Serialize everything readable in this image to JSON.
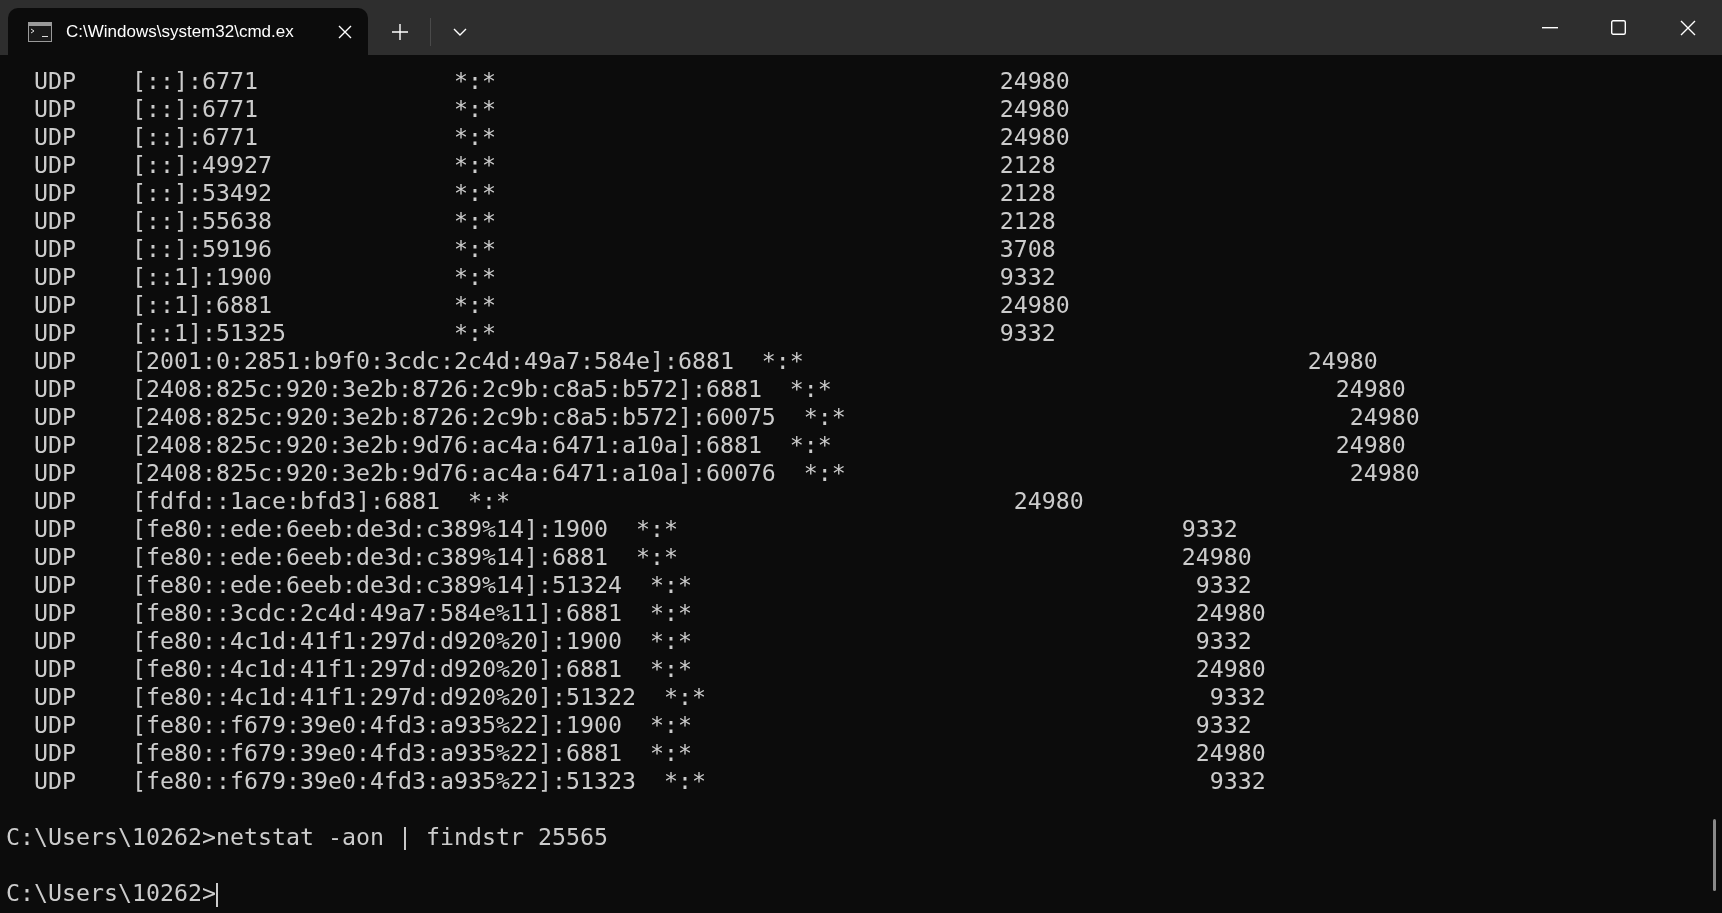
{
  "tab": {
    "title": "C:\\Windows\\system32\\cmd.ex",
    "selected": true
  },
  "rows": [
    {
      "proto": "UDP",
      "local": "[::]:6771",
      "foreign": "*:*",
      "pid": "24980"
    },
    {
      "proto": "UDP",
      "local": "[::]:6771",
      "foreign": "*:*",
      "pid": "24980"
    },
    {
      "proto": "UDP",
      "local": "[::]:6771",
      "foreign": "*:*",
      "pid": "24980"
    },
    {
      "proto": "UDP",
      "local": "[::]:49927",
      "foreign": "*:*",
      "pid": "2128"
    },
    {
      "proto": "UDP",
      "local": "[::]:53492",
      "foreign": "*:*",
      "pid": "2128"
    },
    {
      "proto": "UDP",
      "local": "[::]:55638",
      "foreign": "*:*",
      "pid": "2128"
    },
    {
      "proto": "UDP",
      "local": "[::]:59196",
      "foreign": "*:*",
      "pid": "3708"
    },
    {
      "proto": "UDP",
      "local": "[::1]:1900",
      "foreign": "*:*",
      "pid": "9332"
    },
    {
      "proto": "UDP",
      "local": "[::1]:6881",
      "foreign": "*:*",
      "pid": "24980"
    },
    {
      "proto": "UDP",
      "local": "[::1]:51325",
      "foreign": "*:*",
      "pid": "9332"
    },
    {
      "proto": "UDP",
      "local": "[2001:0:2851:b9f0:3cdc:2c4d:49a7:584e]:6881",
      "foreign": "*:*",
      "pid": "24980"
    },
    {
      "proto": "UDP",
      "local": "[2408:825c:920:3e2b:8726:2c9b:c8a5:b572]:6881",
      "foreign": "*:*",
      "pid": "24980"
    },
    {
      "proto": "UDP",
      "local": "[2408:825c:920:3e2b:8726:2c9b:c8a5:b572]:60075",
      "foreign": "*:*",
      "pid": "24980"
    },
    {
      "proto": "UDP",
      "local": "[2408:825c:920:3e2b:9d76:ac4a:6471:a10a]:6881",
      "foreign": "*:*",
      "pid": "24980"
    },
    {
      "proto": "UDP",
      "local": "[2408:825c:920:3e2b:9d76:ac4a:6471:a10a]:60076",
      "foreign": "*:*",
      "pid": "24980"
    },
    {
      "proto": "UDP",
      "local": "[fdfd::1ace:bfd3]:6881",
      "foreign": "*:*",
      "pid": "24980"
    },
    {
      "proto": "UDP",
      "local": "[fe80::ede:6eeb:de3d:c389%14]:1900",
      "foreign": "*:*",
      "pid": "9332"
    },
    {
      "proto": "UDP",
      "local": "[fe80::ede:6eeb:de3d:c389%14]:6881",
      "foreign": "*:*",
      "pid": "24980"
    },
    {
      "proto": "UDP",
      "local": "[fe80::ede:6eeb:de3d:c389%14]:51324",
      "foreign": "*:*",
      "pid": "9332"
    },
    {
      "proto": "UDP",
      "local": "[fe80::3cdc:2c4d:49a7:584e%11]:6881",
      "foreign": "*:*",
      "pid": "24980"
    },
    {
      "proto": "UDP",
      "local": "[fe80::4c1d:41f1:297d:d920%20]:1900",
      "foreign": "*:*",
      "pid": "9332"
    },
    {
      "proto": "UDP",
      "local": "[fe80::4c1d:41f1:297d:d920%20]:6881",
      "foreign": "*:*",
      "pid": "24980"
    },
    {
      "proto": "UDP",
      "local": "[fe80::4c1d:41f1:297d:d920%20]:51322",
      "foreign": "*:*",
      "pid": "9332"
    },
    {
      "proto": "UDP",
      "local": "[fe80::f679:39e0:4fd3:a935%22]:1900",
      "foreign": "*:*",
      "pid": "9332"
    },
    {
      "proto": "UDP",
      "local": "[fe80::f679:39e0:4fd3:a935%22]:6881",
      "foreign": "*:*",
      "pid": "24980"
    },
    {
      "proto": "UDP",
      "local": "[fe80::f679:39e0:4fd3:a935%22]:51323",
      "foreign": "*:*",
      "pid": "9332"
    }
  ],
  "prompts": [
    {
      "text": "C:\\Users\\10262>netstat -aon | findstr 25565",
      "cursor": false
    },
    {
      "text": "C:\\Users\\10262>",
      "cursor": true
    }
  ]
}
